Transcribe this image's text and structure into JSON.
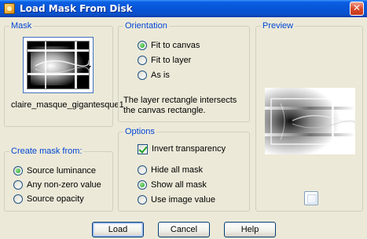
{
  "window": {
    "title": "Load Mask From Disk",
    "close_glyph": "✕"
  },
  "mask": {
    "group_label": "Mask",
    "file_name": "claire_masque_gigantesque1"
  },
  "create_mask_from": {
    "group_label": "Create mask from:",
    "options": [
      {
        "label": "Source luminance",
        "checked": true
      },
      {
        "label": "Any non-zero value",
        "checked": false
      },
      {
        "label": "Source opacity",
        "checked": false
      }
    ]
  },
  "orientation": {
    "group_label": "Orientation",
    "options": [
      {
        "label": "Fit to canvas",
        "checked": true
      },
      {
        "label": "Fit to layer",
        "checked": false
      },
      {
        "label": "As is",
        "checked": false
      }
    ],
    "info_text": "The layer rectangle intersects the canvas rectangle."
  },
  "options": {
    "group_label": "Options",
    "invert_transparency": {
      "label": "Invert transparency",
      "checked": true
    },
    "mask_display": [
      {
        "label": "Hide all mask",
        "checked": false
      },
      {
        "label": "Show all mask",
        "checked": true
      },
      {
        "label": "Use image value",
        "checked": false
      }
    ]
  },
  "preview": {
    "group_label": "Preview"
  },
  "buttons": {
    "load": "Load",
    "cancel": "Cancel",
    "help": "Help"
  },
  "icons": {
    "app": "mask-app-icon",
    "close": "close-icon",
    "dropdown": "chevron-down-icon",
    "preview_toggle": "preview-toggle-icon"
  },
  "colors": {
    "titlebar": "#0856d8",
    "group_title": "#0046d5",
    "dialog_bg": "#ece9d8",
    "check_green": "#21a121"
  }
}
